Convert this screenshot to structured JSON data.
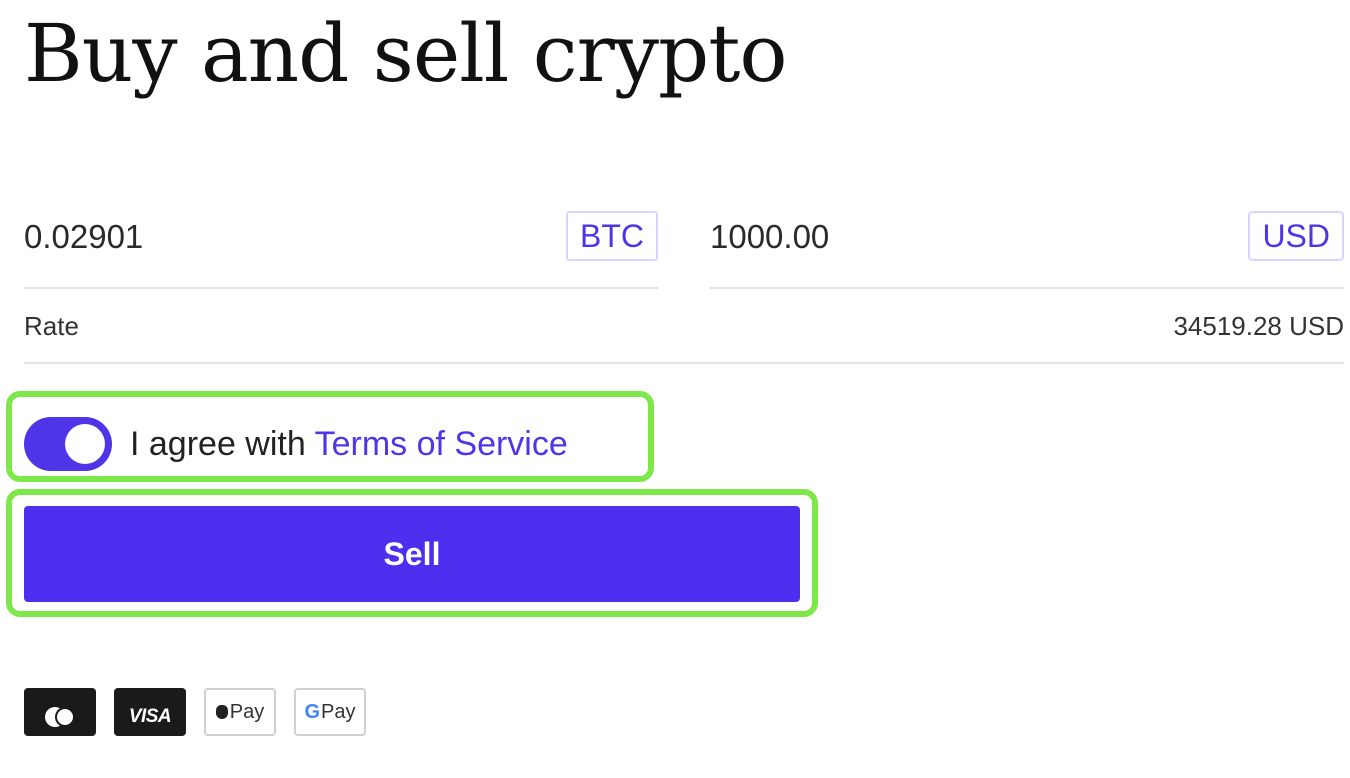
{
  "page": {
    "title": "Buy and sell crypto"
  },
  "exchange": {
    "from": {
      "amount": "0.02901",
      "currency": "BTC"
    },
    "to": {
      "amount": "1000.00",
      "currency": "USD"
    },
    "rate": {
      "label": "Rate",
      "value": "34519.28 USD"
    }
  },
  "agreement": {
    "enabled": true,
    "text": "I agree with ",
    "link_text": "Terms of Service"
  },
  "sell_button": {
    "label": "Sell"
  },
  "payment_methods": [
    {
      "name": "mastercard",
      "icon": "mastercard-icon"
    },
    {
      "name": "visa",
      "icon": "visa-icon",
      "label": "VISA"
    },
    {
      "name": "apple-pay",
      "icon": "apple-pay-icon",
      "label": "Pay"
    },
    {
      "name": "google-pay",
      "icon": "google-pay-icon",
      "label": "Pay",
      "prefix": "G"
    }
  ],
  "colors": {
    "accent": "#4f35e8",
    "button": "#4e2ff0",
    "highlight": "#7ee84a"
  }
}
